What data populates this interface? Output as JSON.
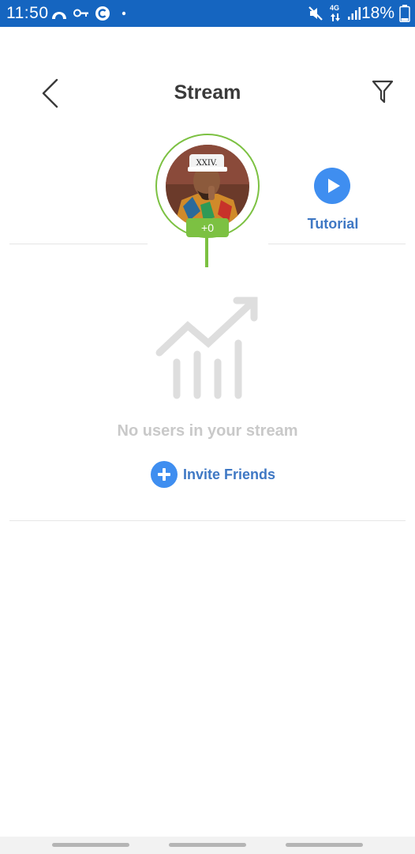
{
  "status_bar": {
    "time": "11:50",
    "network": "4G",
    "battery": "18%",
    "icons": [
      "weather-icon",
      "vpn-key-icon",
      "c-app-icon",
      "dot-icon",
      "mute-icon",
      "signal-icon",
      "battery-icon"
    ]
  },
  "header": {
    "title": "Stream",
    "back_icon": "chevron-left-icon",
    "filter_icon": "filter-icon"
  },
  "profile": {
    "score": "+0",
    "accent_color": "#7cc142"
  },
  "tutorial": {
    "label": "Tutorial",
    "icon": "play-icon",
    "color": "#3f8ef0"
  },
  "empty_state": {
    "icon": "growth-chart-icon",
    "message": "No users in your stream",
    "invite_label": "Invite Friends",
    "invite_icon": "plus-icon"
  },
  "colors": {
    "status_bar": "#1565c0",
    "link": "#3f78c4",
    "muted_text": "#c9c9c9"
  }
}
